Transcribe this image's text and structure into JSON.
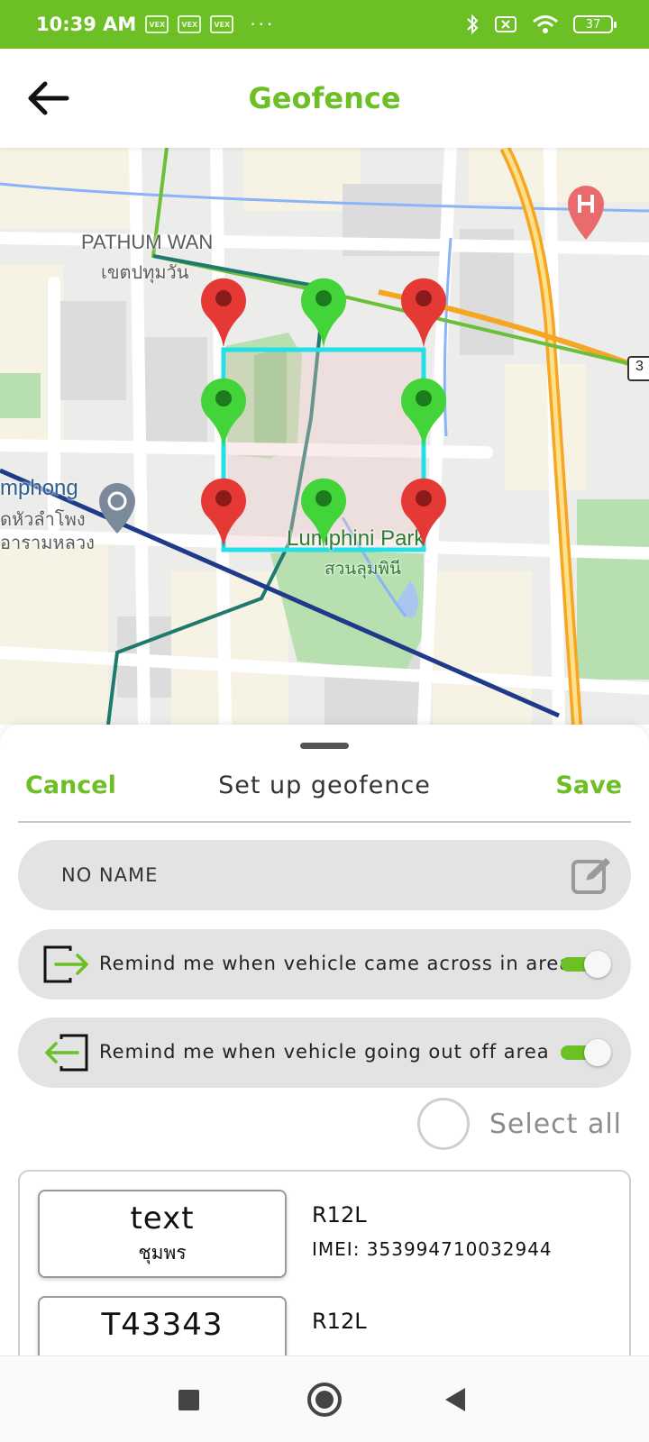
{
  "status_bar": {
    "time": "10:39 AM",
    "notification_icons": [
      "VEX",
      "VEX",
      "VEX"
    ],
    "more": "···",
    "battery": "37",
    "icons": [
      "bluetooth-icon",
      "sim-off-icon",
      "wifi-icon",
      "battery-icon"
    ]
  },
  "header": {
    "title": "Geofence",
    "back_icon": "arrow-left-icon"
  },
  "map": {
    "labels": {
      "pathum_wan_en": "PATHUM WAN",
      "pathum_wan_th": "เขตปทุมวัน",
      "hualamphong_en": "mphong",
      "hualamphong_th1": "ัดหัวลำโพง",
      "hualamphong_th2": "อารามหลวง",
      "lumphini_en": "Lumphini Park",
      "lumphini_th": "สวนลุมพินี",
      "route_shield": "3"
    },
    "pin_colors": {
      "corner": "#e53935",
      "mid": "#43d43a"
    }
  },
  "sheet": {
    "cancel_label": "Cancel",
    "title": "Set up geofence",
    "save_label": "Save",
    "name_value": "NO NAME",
    "remind_in_label": "Remind me when vehicle came across in area",
    "remind_in_on": true,
    "remind_out_label": "Remind me when vehicle going out off area",
    "remind_out_on": true,
    "select_all_label": "Select all"
  },
  "vehicles": [
    {
      "plate_number": "text",
      "province": "ชุมพร",
      "model": "R12L",
      "imei": "IMEI: 353994710032944"
    },
    {
      "plate_number": "T43343",
      "province": "",
      "model": "R12L",
      "imei": ""
    }
  ],
  "colors": {
    "accent": "#6cbf24",
    "geofence_border": "#22e0e6"
  }
}
